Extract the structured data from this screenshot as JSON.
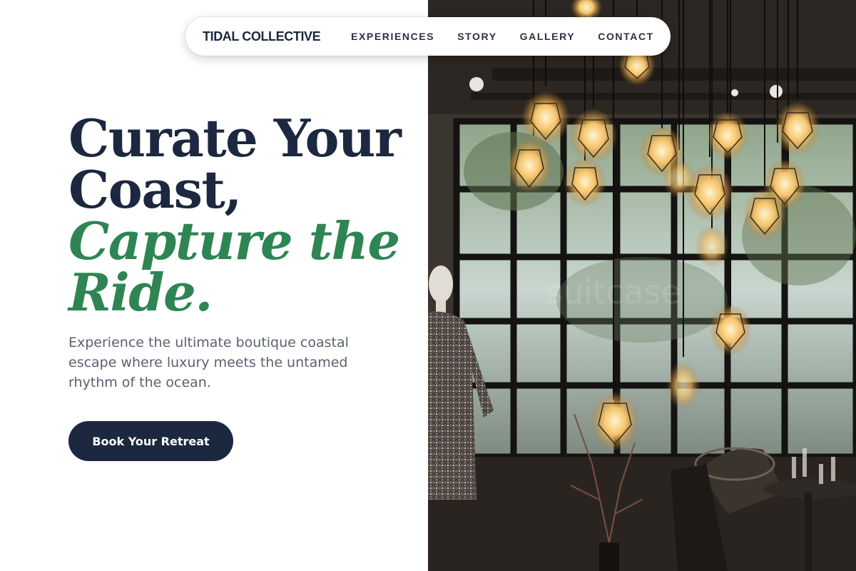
{
  "nav": {
    "brand": "TIDAL COLLECTIVE",
    "links": [
      "EXPERIENCES",
      "STORY",
      "GALLERY",
      "CONTACT"
    ]
  },
  "hero": {
    "headline_line1": "Curate Your",
    "headline_line2": "Coast,",
    "headline_line3": "Capture the",
    "headline_line4": "Ride.",
    "description": "Experience the ultimate boutique coastal escape where luxury meets the untamed rhythm of the ocean.",
    "cta_label": "Book Your Retreat"
  },
  "photo": {
    "subject": "boutique interior with hanging edison cage pendant lights, mannequin in tweed coat, window panes and wicker chairs"
  },
  "colors": {
    "navy": "#1c2740",
    "green": "#2e8553",
    "body_text": "#5b6170",
    "white": "#ffffff"
  }
}
